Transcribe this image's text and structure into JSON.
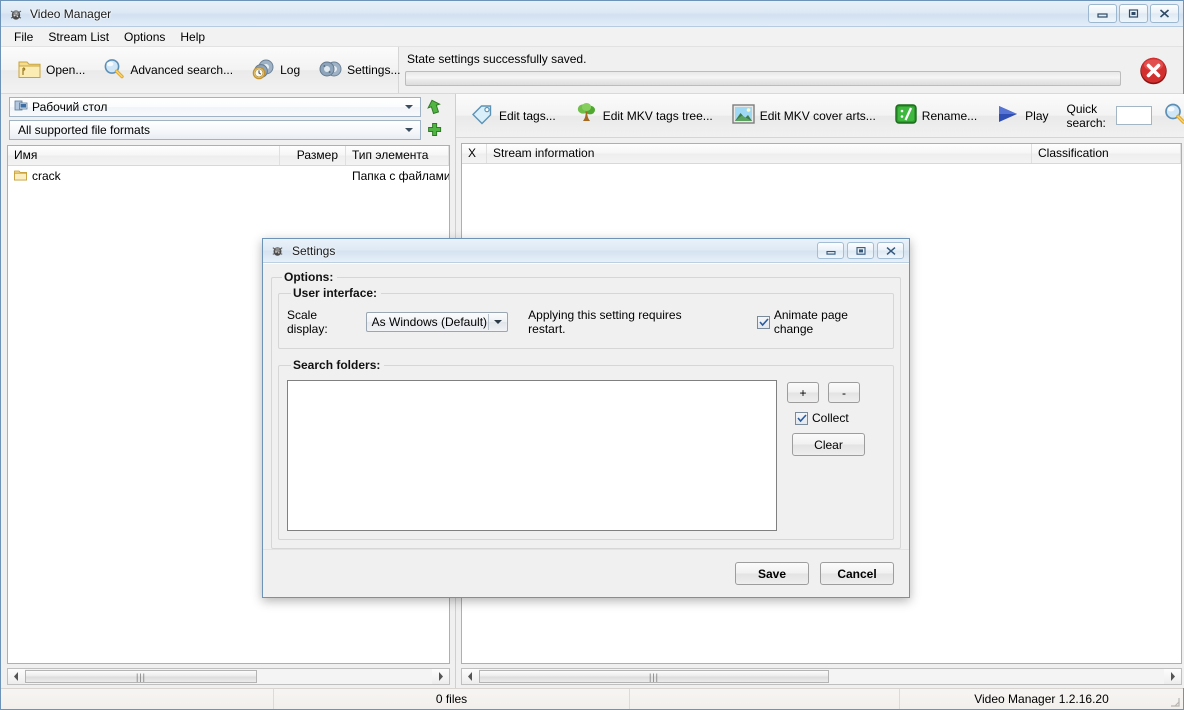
{
  "window": {
    "title": "Video Manager",
    "icon": "app-bug-icon",
    "controls": [
      {
        "name": "minimize",
        "glyph": "minimize-icon"
      },
      {
        "name": "maximize",
        "glyph": "maximize-icon"
      },
      {
        "name": "close",
        "glyph": "close-icon"
      }
    ]
  },
  "menu": {
    "items": [
      {
        "label": "File"
      },
      {
        "label": "Stream List"
      },
      {
        "label": "Options"
      },
      {
        "label": "Help"
      }
    ]
  },
  "toolbar": {
    "buttons": [
      {
        "label": "Open...",
        "icon": "open-folder-icon"
      },
      {
        "label": "Advanced search...",
        "icon": "magnifier-icon"
      },
      {
        "label": "Log",
        "icon": "gears-clock-icon"
      },
      {
        "label": "Settings...",
        "icon": "gears-icon"
      }
    ]
  },
  "status": {
    "message": "State settings successfully saved.",
    "progress_percent": 0,
    "cancel_icon": "red-close-circle-icon"
  },
  "left_panel": {
    "path_combo": {
      "value": "Рабочий стол",
      "icon": "desktop-icon"
    },
    "up_button_icon": "green-up-arrow-icon",
    "filter_combo": {
      "value": "All supported file formats"
    },
    "add_button_icon": "green-plus-icon",
    "columns": [
      {
        "label": "Имя"
      },
      {
        "label": "Размер"
      },
      {
        "label": "Тип элемента"
      }
    ],
    "rows": [
      {
        "icon": "folder-icon",
        "name": "crack",
        "size": "",
        "type": "Папка с файлами"
      }
    ]
  },
  "right_panel": {
    "toolbar": [
      {
        "label": "Edit tags...",
        "icon": "tag-icon"
      },
      {
        "label": "Edit MKV tags tree...",
        "icon": "tree-icon"
      },
      {
        "label": "Edit MKV cover arts...",
        "icon": "picture-icon"
      },
      {
        "label": "Rename...",
        "icon": "rename-icon"
      },
      {
        "label": "Play",
        "icon": "play-icon"
      }
    ],
    "quick_search": {
      "label": "Quick search:",
      "value": "",
      "search_icon": "magnifier-icon"
    },
    "columns": [
      {
        "label": "X"
      },
      {
        "label": "Stream information"
      },
      {
        "label": "Classification"
      }
    ],
    "rows": []
  },
  "statusbar": {
    "cells": [
      "",
      "0 files",
      "",
      "Video Manager 1.2.16.20"
    ],
    "resize_grip": "resize-grip-icon"
  },
  "dialog": {
    "title": "Settings",
    "icon": "app-bug-icon",
    "controls": [
      {
        "name": "minimize",
        "glyph": "minimize-icon"
      },
      {
        "name": "maximize",
        "glyph": "maximize-icon"
      },
      {
        "name": "close",
        "glyph": "close-icon"
      }
    ],
    "options_legend": "Options:",
    "ui_group": {
      "legend": "User interface:",
      "scale_label": "Scale display:",
      "scale_value": "As Windows (Default)",
      "scale_options": [
        "As Windows (Default)"
      ],
      "restart_note": "Applying this setting requires restart.",
      "animate_checkbox": {
        "label": "Animate page change",
        "checked": true
      }
    },
    "search_group": {
      "legend": "Search folders:",
      "folders": [],
      "add_label": "+",
      "remove_label": "-",
      "collect_checkbox": {
        "label": "Collect",
        "checked": true
      },
      "clear_label": "Clear"
    },
    "save_label": "Save",
    "cancel_label": "Cancel"
  }
}
